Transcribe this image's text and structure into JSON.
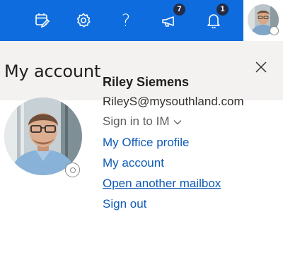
{
  "topbar": {
    "buttons": [
      {
        "icon": "calendar-edit-icon"
      },
      {
        "icon": "gear-icon"
      },
      {
        "icon": "help-icon",
        "label": "?"
      },
      {
        "icon": "megaphone-icon",
        "badge": "7"
      },
      {
        "icon": "bell-icon",
        "badge": "1"
      }
    ],
    "avatar_icon": "user-avatar"
  },
  "panel": {
    "title": "My account",
    "close_icon": "close-icon"
  },
  "user": {
    "name": "Riley Siemens",
    "email": "RileyS@mysouthland.com",
    "sign_in_label": "Sign in to IM"
  },
  "links": {
    "office_profile": "My Office profile",
    "my_account": "My account",
    "open_mailbox": "Open another mailbox",
    "sign_out": "Sign out"
  },
  "colors": {
    "accent": "#0f6cde",
    "link": "#0f5bb5",
    "panel_header": "#f3f2f1"
  }
}
